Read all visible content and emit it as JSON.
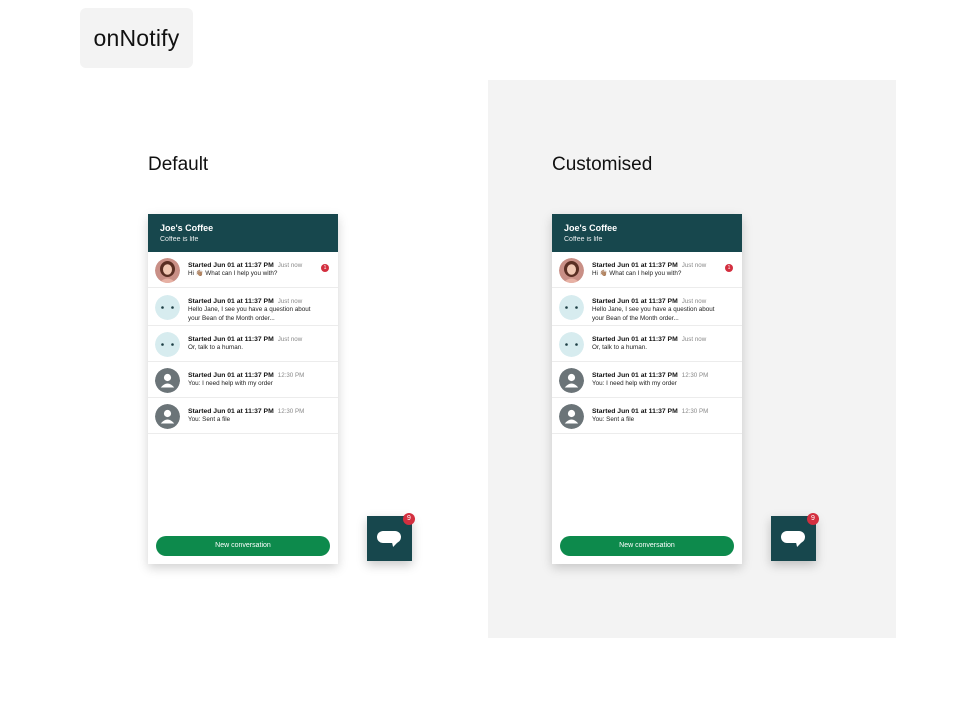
{
  "app": {
    "title": "onNotify"
  },
  "sections": {
    "default": {
      "label": "Default"
    },
    "customised": {
      "label": "Customised"
    }
  },
  "widget": {
    "header_title": "Joe's Coffee",
    "header_subtitle": "Coffee is life",
    "new_conversation_label": "New conversation",
    "launcher_badge_count": "9",
    "conversations": [
      {
        "started": "Started Jun 01 at 11:37 PM",
        "time": "Just now",
        "message": "Hi 👋🏽 What can I help you with?",
        "avatar": "person-photo",
        "unread": "1"
      },
      {
        "started": "Started Jun 01 at 11:37 PM",
        "time": "Just now",
        "message": "Hello Jane, I see you have a question about your Bean of the Month order...",
        "avatar": "bot-face"
      },
      {
        "started": "Started Jun 01 at 11:37 PM",
        "time": "Just now",
        "message": "Or, talk to a human.",
        "avatar": "bot-face"
      },
      {
        "started": "Started Jun 01 at 11:37 PM",
        "time": "12:30 PM",
        "message": "You: I need help with my order",
        "avatar": "user-generic"
      },
      {
        "started": "Started Jun 01 at 11:37 PM",
        "time": "12:30 PM",
        "message": "You: Sent a file",
        "avatar": "user-generic"
      }
    ]
  },
  "colors": {
    "header_bg": "#17474d",
    "button_bg": "#0d8a4c",
    "badge_bg": "#d32f3f",
    "panel_bg": "#f3f3f3"
  }
}
